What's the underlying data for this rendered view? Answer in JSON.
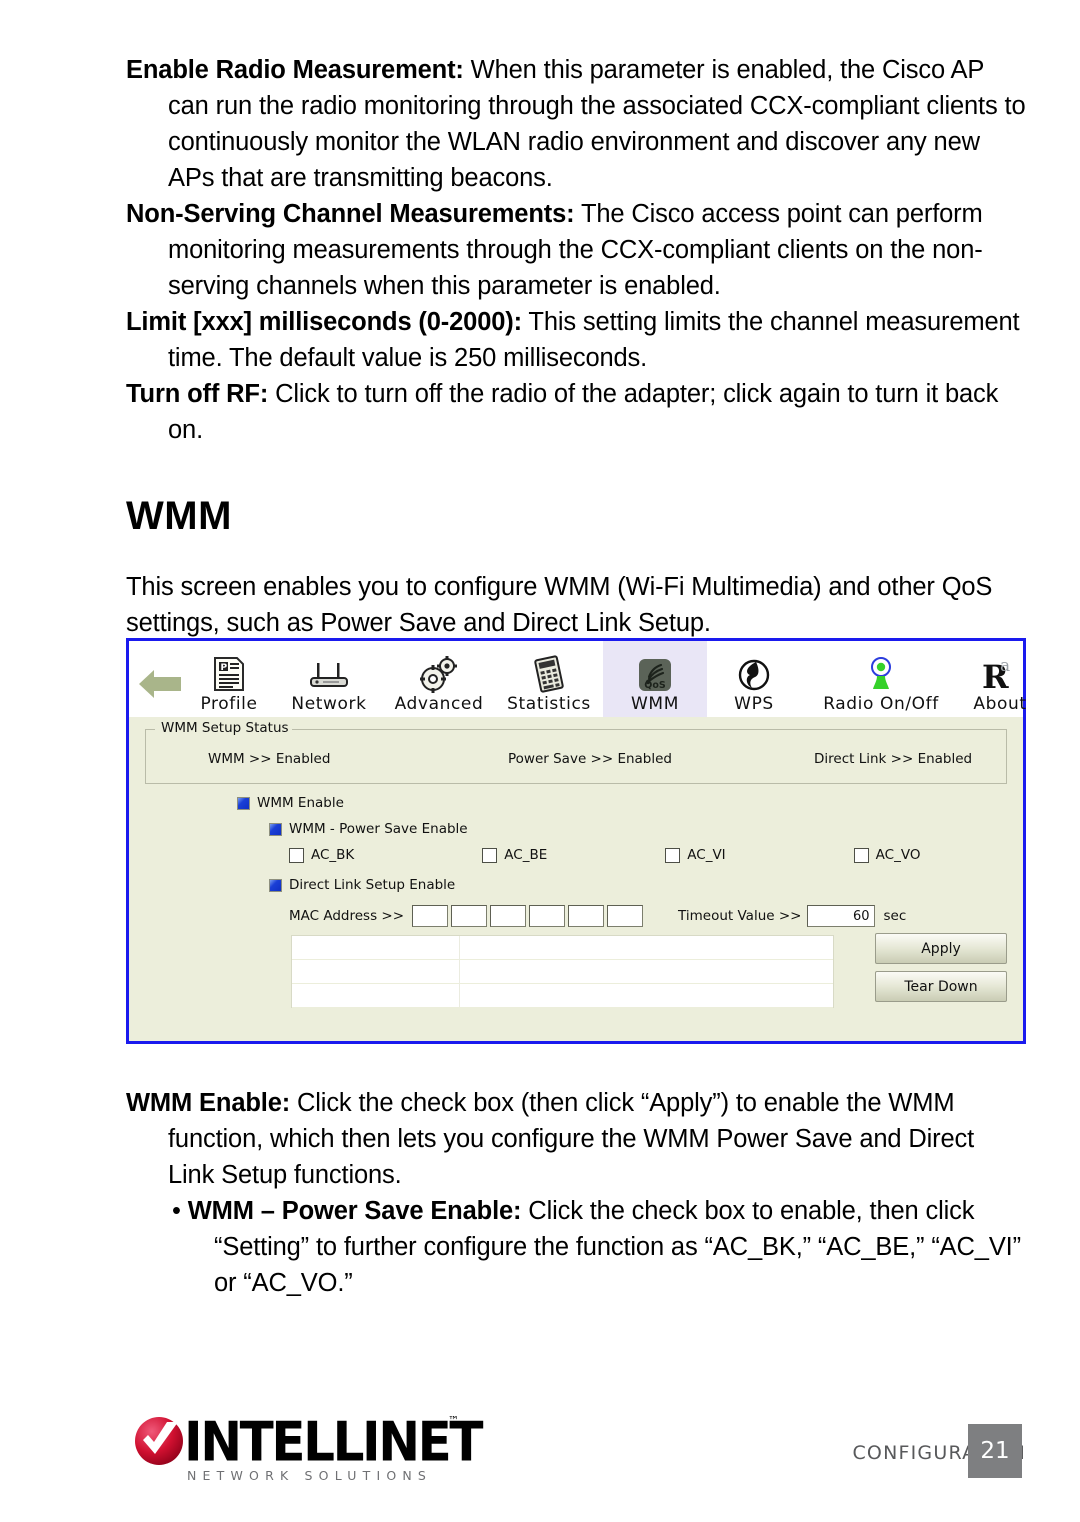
{
  "document": {
    "paragraphs": [
      {
        "term": "Enable Radio Measurement:",
        "text": " When this parameter is enabled, the Cisco AP can run the radio monitoring through the associated CCX-compliant clients to continuously monitor the WLAN radio environment and discover any new APs that are transmitting beacons."
      },
      {
        "term": "Non-Serving Channel Measurements:",
        "text": " The Cisco access point can perform monitoring measurements through the CCX-compliant clients on the non-serving channels when this parameter is enabled."
      },
      {
        "term": "Limit [xxx] milliseconds (0-2000):",
        "text": " This setting limits the channel measurement time. The default value is 250 milliseconds."
      },
      {
        "term": "Turn off RF:",
        "text": " Click to turn off the radio of the adapter; click again to turn it back on."
      }
    ],
    "section_heading": "WMM",
    "intro": "This screen enables you to configure WMM (Wi-Fi Multimedia) and other QoS settings, such as Power Save and Direct Link Setup.",
    "after_paragraphs": [
      {
        "term": "WMM Enable:",
        "text": " Click the check box (then click “Apply”) to enable the WMM function, which then lets you configure the WMM Power Save and Direct Link Setup functions."
      }
    ],
    "bullets": [
      {
        "marker": "• ",
        "term": "WMM – Power Save Enable:",
        "text": " Click the check box to enable, then click “Setting” to further configure the function as “AC_BK,” “AC_BE,” “AC_VI” or “AC_VO.”"
      }
    ]
  },
  "screenshot": {
    "toolbar": {
      "back_icon": "back-arrow-icon",
      "tabs": [
        {
          "label": "Profile",
          "icon": "profile-document-icon",
          "selected": false
        },
        {
          "label": "Network",
          "icon": "router-icon",
          "selected": false
        },
        {
          "label": "Advanced",
          "icon": "gears-icon",
          "selected": false
        },
        {
          "label": "Statistics",
          "icon": "calculator-icon",
          "selected": false
        },
        {
          "label": "WMM",
          "icon": "qos-icon",
          "selected": true
        },
        {
          "label": "WPS",
          "icon": "wps-icon",
          "selected": false
        },
        {
          "label": "Radio On/Off",
          "icon": "radio-antenna-icon",
          "selected": false
        },
        {
          "label": "About",
          "icon": "registered-r-icon",
          "selected": false
        }
      ]
    },
    "setup_status": {
      "group_title": "WMM Setup Status",
      "items": [
        "WMM >> Enabled",
        "Power Save >> Enabled",
        "Direct Link >> Enabled"
      ]
    },
    "checkboxes": {
      "wmm_enable": {
        "label": "WMM Enable",
        "checked": true
      },
      "power_save_enable": {
        "label": "WMM - Power Save Enable",
        "checked": true
      },
      "direct_link_enable": {
        "label": "Direct Link Setup Enable",
        "checked": true
      },
      "access_categories": [
        {
          "label": "AC_BK",
          "checked": false
        },
        {
          "label": "AC_BE",
          "checked": false
        },
        {
          "label": "AC_VI",
          "checked": false
        },
        {
          "label": "AC_VO",
          "checked": false
        }
      ]
    },
    "direct_link": {
      "mac_label": "MAC Address >>",
      "mac_octets": [
        "",
        "",
        "",
        "",
        "",
        ""
      ],
      "timeout_label": "Timeout Value >>",
      "timeout_value": "60",
      "timeout_unit": "sec"
    },
    "buttons": {
      "apply": "Apply",
      "tear_down": "Tear Down"
    },
    "colors": {
      "panel_border": "#1a1aee",
      "panel_background": "#eceedb",
      "selected_tab": "#e9e6f6",
      "checkbox_checked": "#1a3fd6"
    }
  },
  "footer": {
    "brand": "INTELLINET",
    "trademark": "™",
    "tagline": "NETWORK SOLUTIONS",
    "section": "CONFIGURATION",
    "page_number": "21"
  }
}
